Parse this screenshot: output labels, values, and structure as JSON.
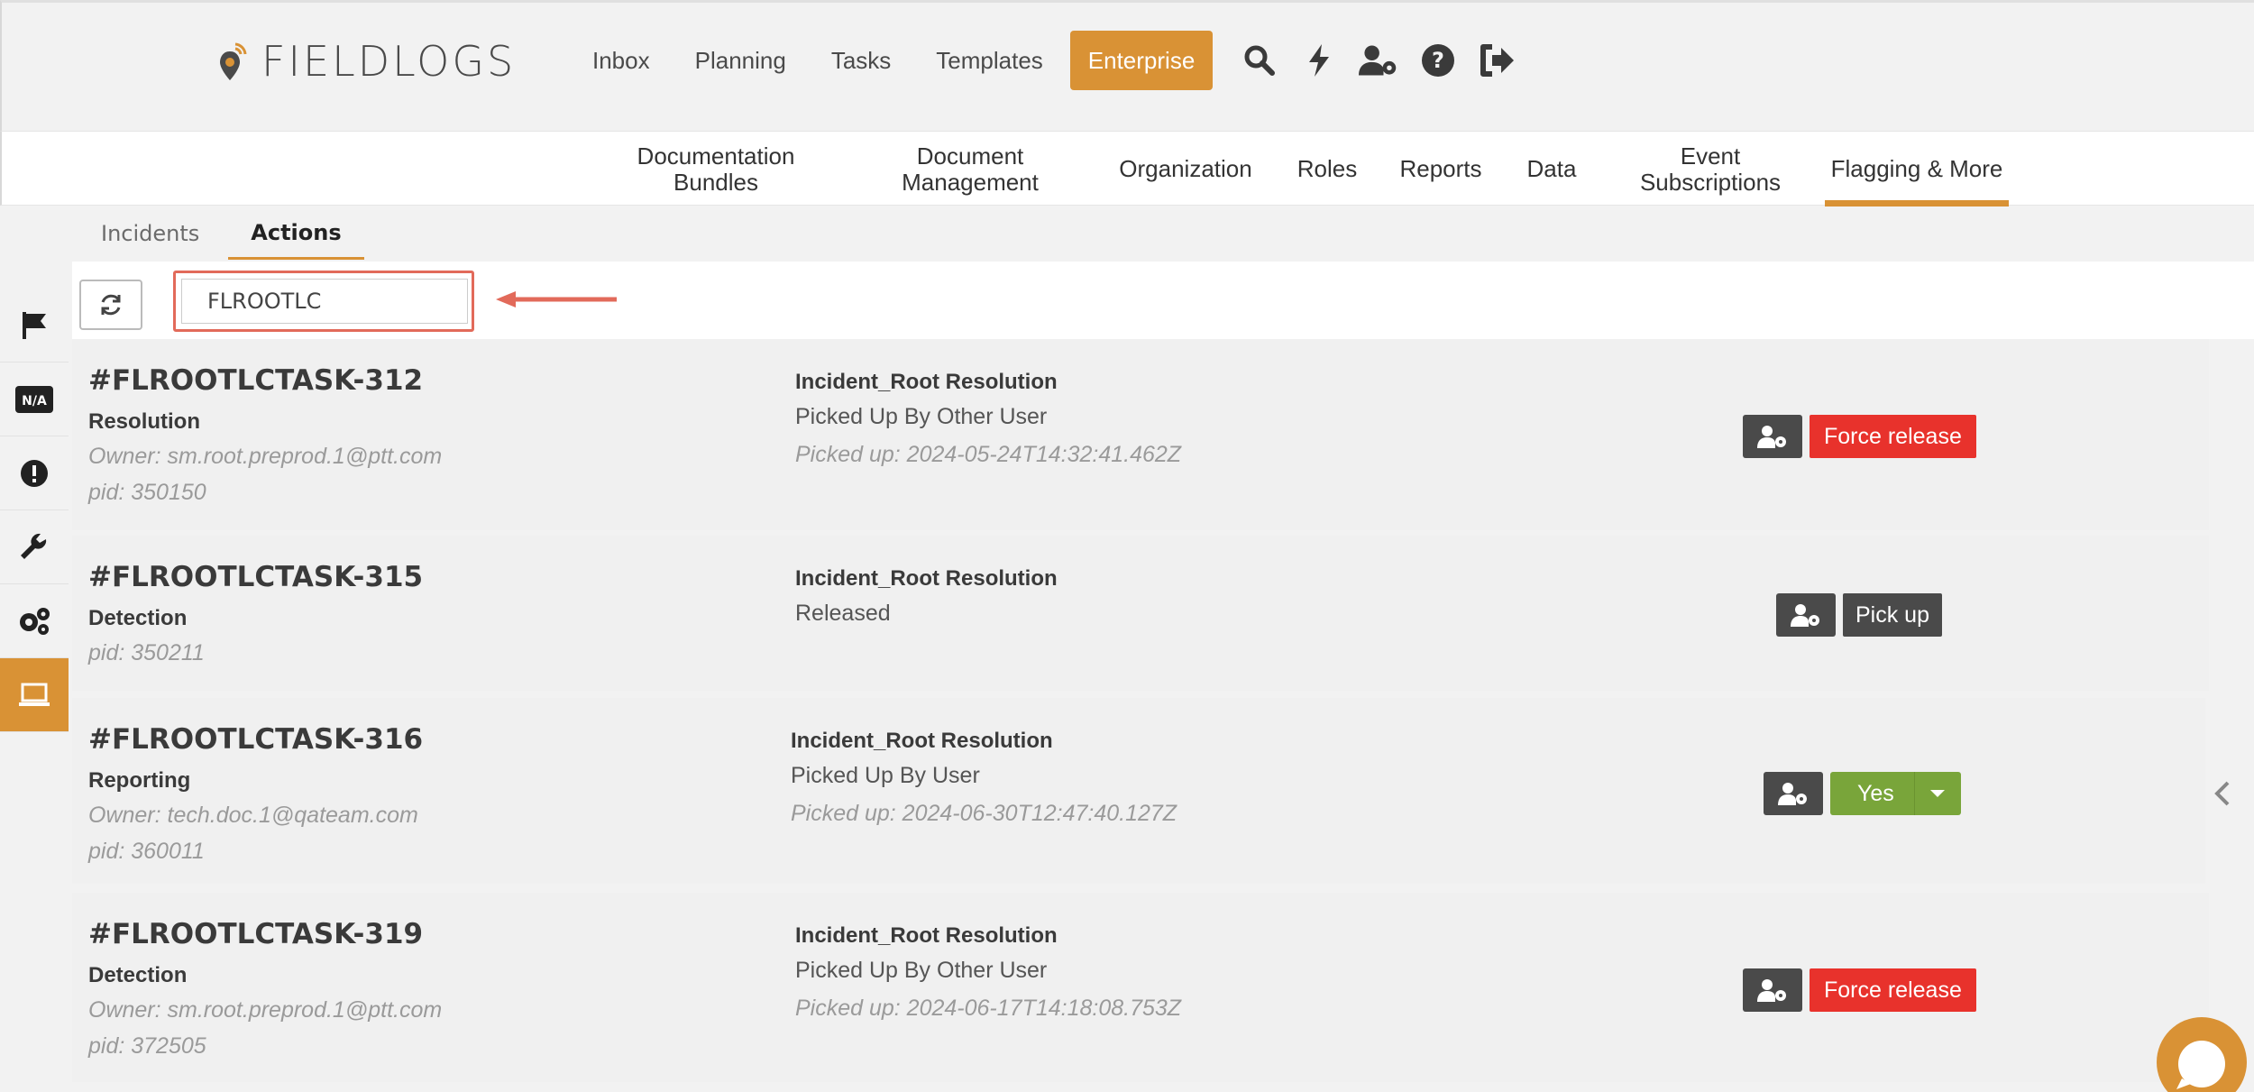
{
  "header": {
    "logo_text": "FIELDLOGS",
    "nav": [
      "Inbox",
      "Planning",
      "Tasks",
      "Templates"
    ],
    "enterprise_label": "Enterprise",
    "icons": [
      "search-icon",
      "bolt-icon",
      "user-gear-icon",
      "help-icon",
      "logout-icon"
    ]
  },
  "subnav": {
    "items": [
      {
        "label": "Documentation Bundles"
      },
      {
        "label": "Document Management"
      },
      {
        "label": "Organization"
      },
      {
        "label": "Roles"
      },
      {
        "label": "Reports"
      },
      {
        "label": "Data"
      },
      {
        "label": "Event Subscriptions"
      },
      {
        "label": "Flagging & More",
        "active": true
      }
    ]
  },
  "tabs": [
    {
      "label": "Incidents"
    },
    {
      "label": "Actions",
      "active": true
    }
  ],
  "sidebar": {
    "items": [
      "flag-icon",
      "na-icon",
      "alert-icon",
      "wrench-icon",
      "gears-icon",
      "laptop-icon"
    ],
    "active": "laptop-icon"
  },
  "toolbar": {
    "search_value": "FLROOTLC"
  },
  "rows": [
    {
      "id": "#FLROOTLCTASK-312",
      "type": "Resolution",
      "owner": "Owner: sm.root.preprod.1@ptt.com",
      "pid": "pid: 350150",
      "process": "Incident_Root Resolution",
      "status": "Picked Up By Other User",
      "picked": "Picked up: 2024-05-24T14:32:41.462Z",
      "action": "Force release"
    },
    {
      "id": "#FLROOTLCTASK-315",
      "type": "Detection",
      "pid": "pid: 350211",
      "process": "Incident_Root Resolution",
      "status": "Released",
      "action": "Pick up"
    },
    {
      "id": "#FLROOTLCTASK-316",
      "type": "Reporting",
      "owner": "Owner: tech.doc.1@qateam.com",
      "pid": "pid: 360011",
      "process": "Incident_Root Resolution",
      "status": "Picked Up By User",
      "picked": "Picked up: 2024-06-30T12:47:40.127Z",
      "action": "Yes"
    },
    {
      "id": "#FLROOTLCTASK-319",
      "type": "Detection",
      "owner": "Owner: sm.root.preprod.1@ptt.com",
      "pid": "pid: 372505",
      "process": "Incident_Root Resolution",
      "status": "Picked Up By Other User",
      "picked": "Picked up: 2024-06-17T14:18:08.753Z",
      "action": "Force release"
    }
  ],
  "colors": {
    "accent": "#d99235",
    "danger": "#e8322c",
    "success": "#79a53a",
    "dark": "#4a4a4a"
  }
}
